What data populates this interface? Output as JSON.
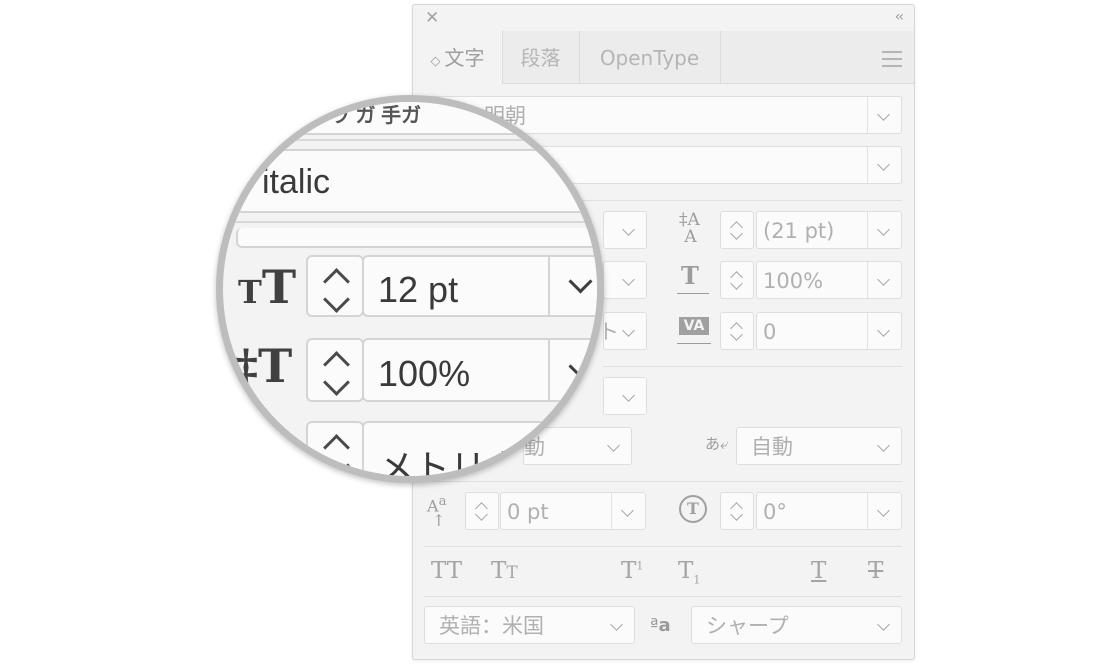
{
  "panel": {
    "tabs": [
      {
        "label": "文字",
        "active": true
      },
      {
        "label": "段落",
        "active": false
      },
      {
        "label": "OpenType",
        "active": false
      }
    ],
    "font_family": "明朝",
    "leading": "(21 pt)",
    "horizontal_scale": "100%",
    "tracking": "0",
    "mojikumi": "自動",
    "baseline_shift": "0 pt",
    "rotation": "0°",
    "language": "英語：米国",
    "antialias": "シャープ",
    "partial_auto": "動",
    "partial_kerning": "ト"
  },
  "magnifier": {
    "top_partial": "ウ ガ 手ガ",
    "font_style": "italic",
    "font_size": "12 pt",
    "vertical_scale": "100%",
    "kerning": "メトリク"
  },
  "colors": {
    "panel_bg": "#f3f3f3",
    "field_bg": "#fbfbfb",
    "border": "#dedede",
    "loupe_ring": "#bdbdbd"
  }
}
